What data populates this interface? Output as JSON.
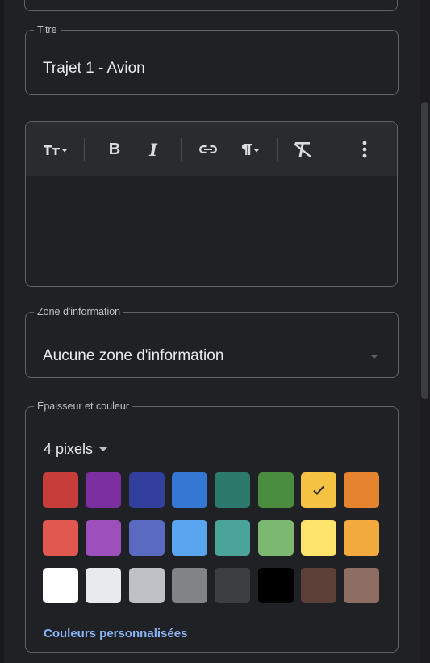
{
  "title_field": {
    "label": "Titre",
    "value": "Trajet 1 - Avion"
  },
  "editor": {
    "toolbar": {
      "text_size_icon": "text-size-icon",
      "bold_label": "B",
      "italic_label": "I",
      "link_icon": "link-icon",
      "paragraph_icon": "paragraph-icon",
      "clear_format_icon": "clear-format-icon",
      "more_icon": "more-vert-icon"
    },
    "content": ""
  },
  "info_zone": {
    "label": "Zone d'information",
    "value": "Aucune zone d'information"
  },
  "thickness_color": {
    "label": "Épaisseur et couleur",
    "thickness": "4 pixels",
    "selected_color": "#f6c244",
    "colors": [
      [
        "#c73d3a",
        "#7b2fa1",
        "#323f9c",
        "#3478d4",
        "#2c7a6b",
        "#4a8c40",
        "#f6c244",
        "#e6832e"
      ],
      [
        "#e0584f",
        "#9d4fbb",
        "#5a6ac0",
        "#59a5f0",
        "#4aa49a",
        "#7cb86f",
        "#fde46c",
        "#f2aa3e"
      ],
      [
        "#ffffff",
        "#e8eaed",
        "#bdc1c6",
        "#808487",
        "#3c3f41",
        "#000000",
        "#5c3f36",
        "#8e6e62"
      ]
    ],
    "custom_colors_label": "Couleurs personnalisées"
  }
}
